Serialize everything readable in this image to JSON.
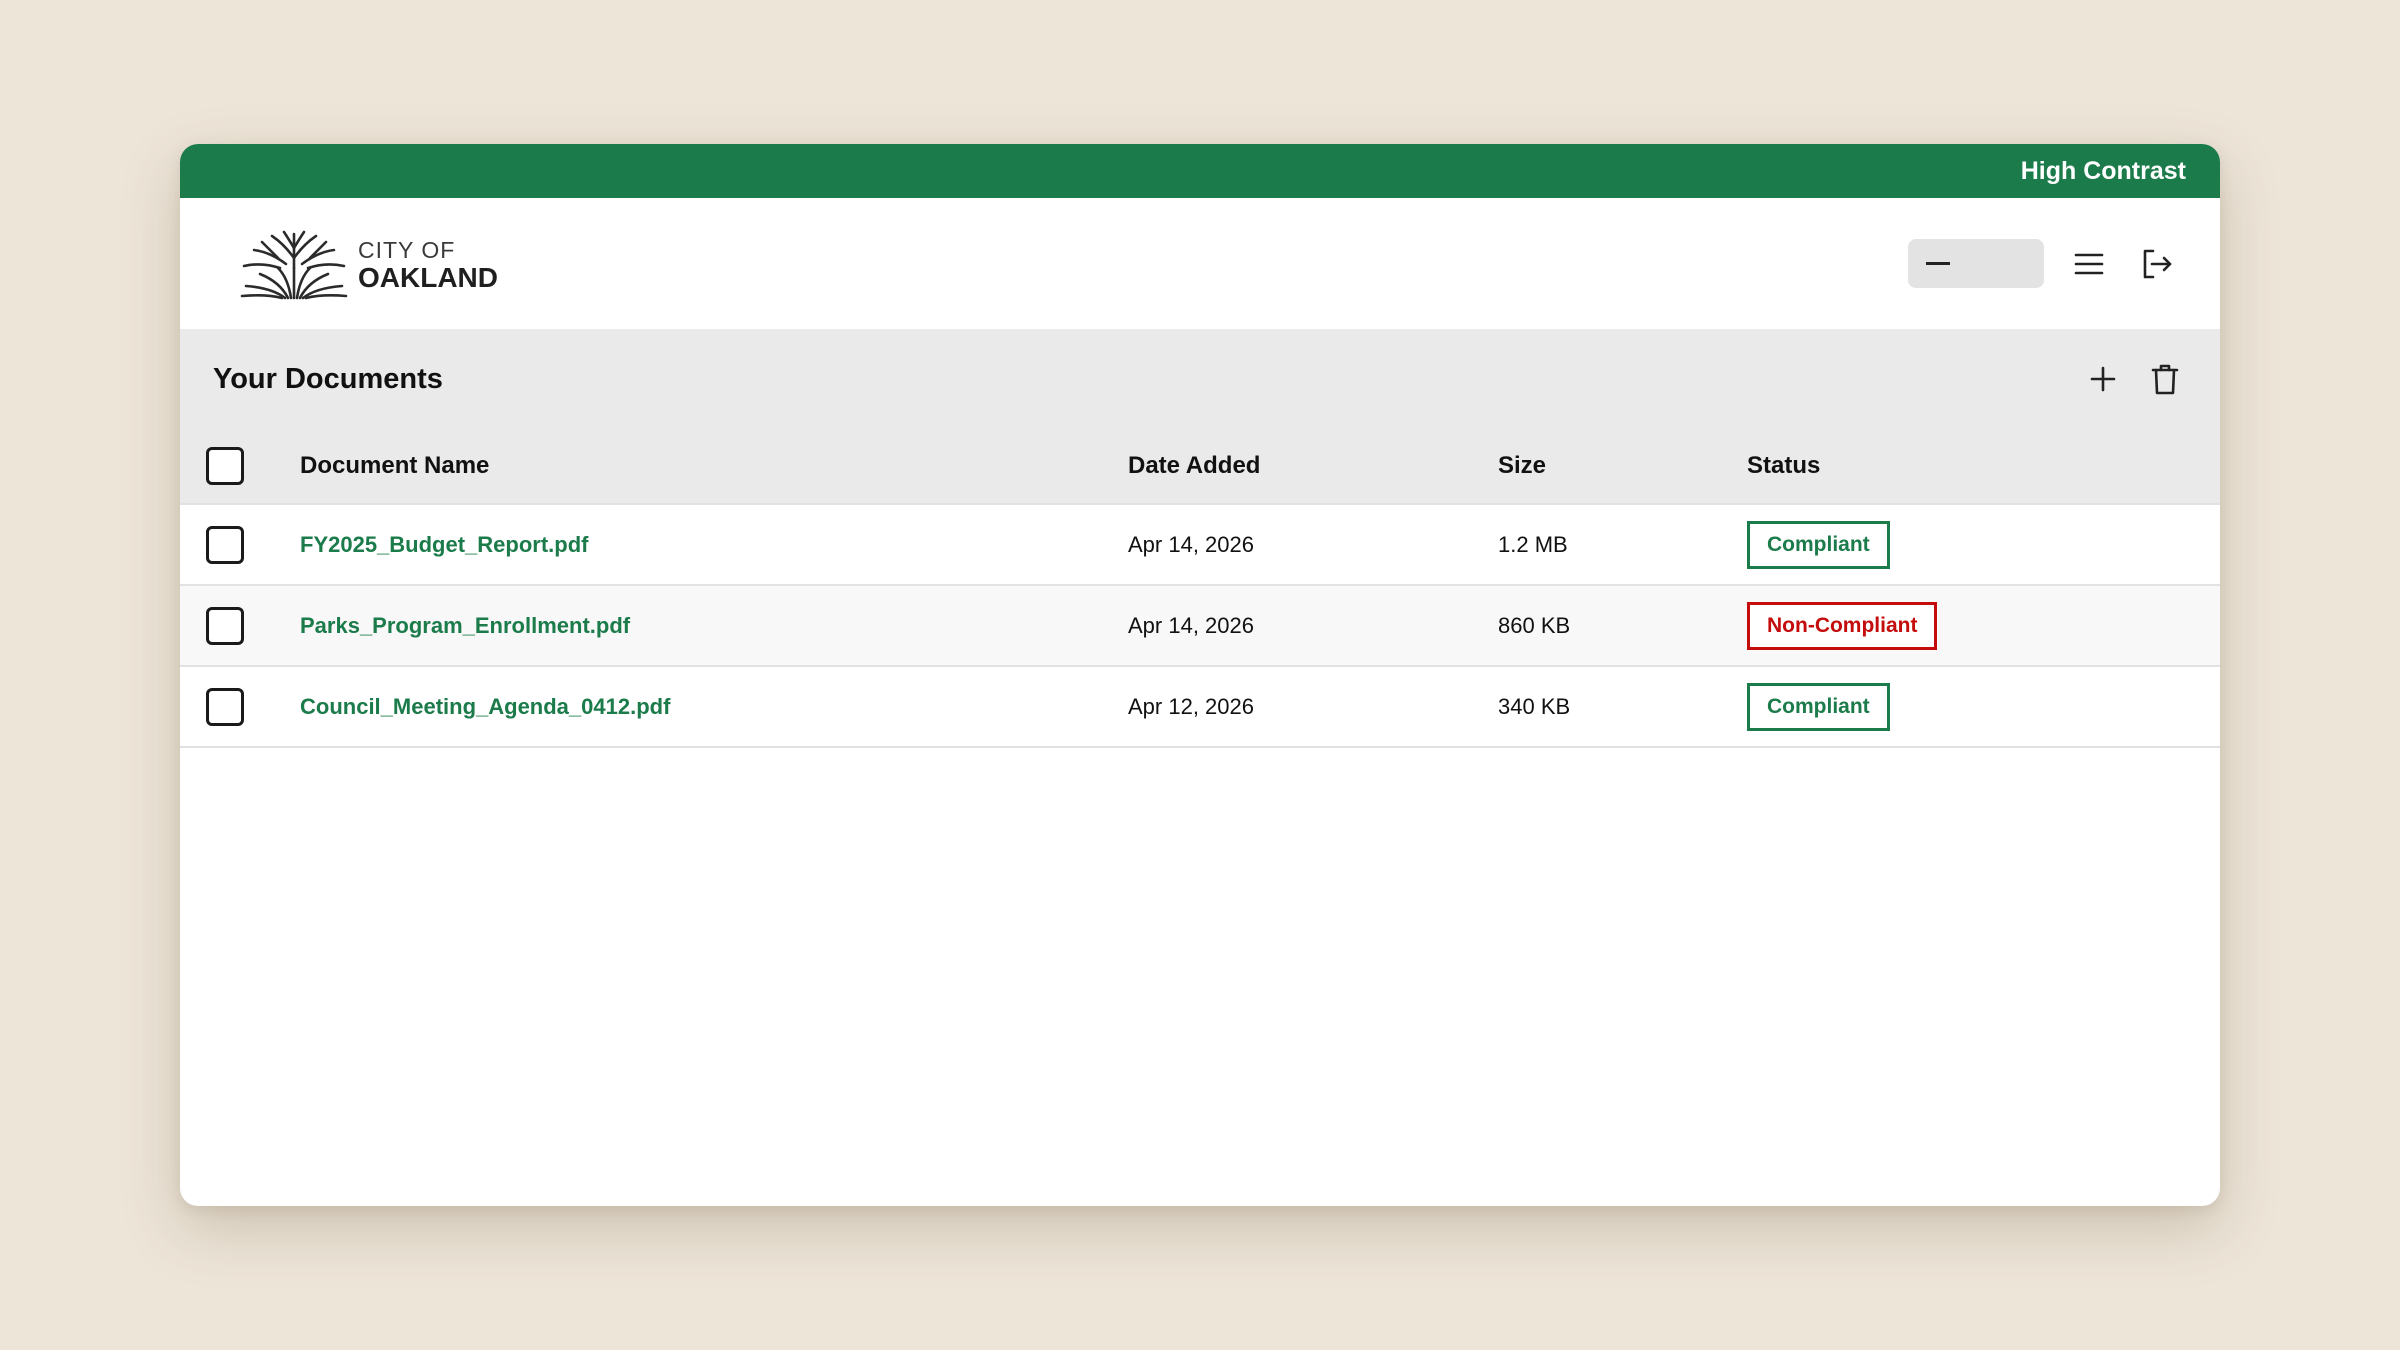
{
  "topbar": {
    "contrast_label": "High Contrast"
  },
  "logo": {
    "line1": "CITY OF",
    "line2": "OAKLAND"
  },
  "header": {
    "user_icon": "dash-icon",
    "menu_icon": "hamburger-menu-icon",
    "logout_icon": "logout-icon"
  },
  "documents": {
    "title": "Your Documents",
    "add_icon": "plus-icon",
    "delete_icon": "trash-icon",
    "columns": {
      "name": "Document Name",
      "date": "Date Added",
      "size": "Size",
      "status": "Status"
    },
    "rows": [
      {
        "name": "FY2025_Budget_Report.pdf",
        "date": "Apr 14, 2026",
        "size": "1.2 MB",
        "status": "Compliant",
        "status_kind": "ok"
      },
      {
        "name": "Parks_Program_Enrollment.pdf",
        "date": "Apr 14, 2026",
        "size": "860 KB",
        "status": "Non-Compliant",
        "status_kind": "bad"
      },
      {
        "name": "Council_Meeting_Agenda_0412.pdf",
        "date": "Apr 12, 2026",
        "size": "340 KB",
        "status": "Compliant",
        "status_kind": "ok"
      }
    ]
  },
  "colors": {
    "brand_green": "#1b7b4a",
    "noncompliant_red": "#c40c0c",
    "page_bg": "#ede5d8"
  }
}
